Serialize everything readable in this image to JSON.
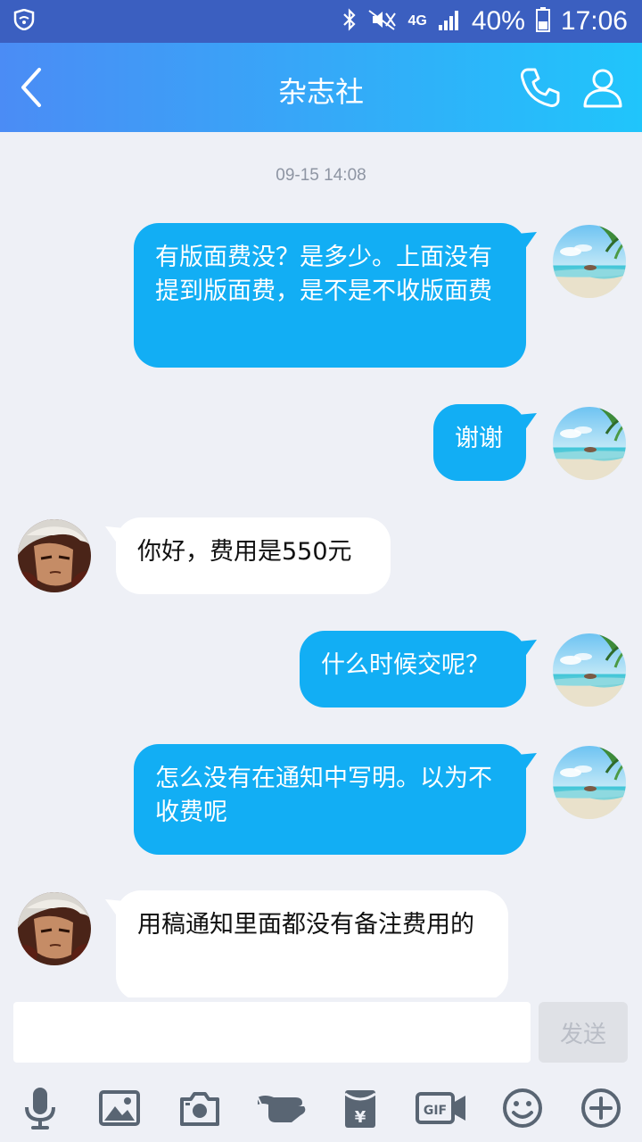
{
  "status_bar": {
    "battery": "40%",
    "time": "17:06",
    "network": "4G"
  },
  "header": {
    "title": "杂志社"
  },
  "chat": {
    "timestamp": "09-15 14:08",
    "messages": [
      {
        "sender": "me",
        "text": "有版面费没？是多少。上面没有提到版面费，是不是不收版面费"
      },
      {
        "sender": "me",
        "text": "谢谢"
      },
      {
        "sender": "them",
        "text": "你好，费用是550元"
      },
      {
        "sender": "me",
        "text": "什么时候交呢？"
      },
      {
        "sender": "me",
        "text": "怎么没有在通知中写明。以为不收费呢"
      },
      {
        "sender": "them",
        "text": "用稿通知里面都没有备注费用的"
      }
    ]
  },
  "composer": {
    "value": "",
    "send_label": "发送"
  },
  "toolbar": {
    "items": [
      "microphone-icon",
      "image-icon",
      "camera-icon",
      "poke-hand-icon",
      "red-packet-icon",
      "gif-icon",
      "emoji-icon",
      "plus-icon"
    ]
  },
  "colors": {
    "my_bubble": "#12aef4",
    "their_bubble": "#ffffff",
    "header_gradient_start": "#4b8cf5",
    "header_gradient_end": "#20c5fb"
  }
}
